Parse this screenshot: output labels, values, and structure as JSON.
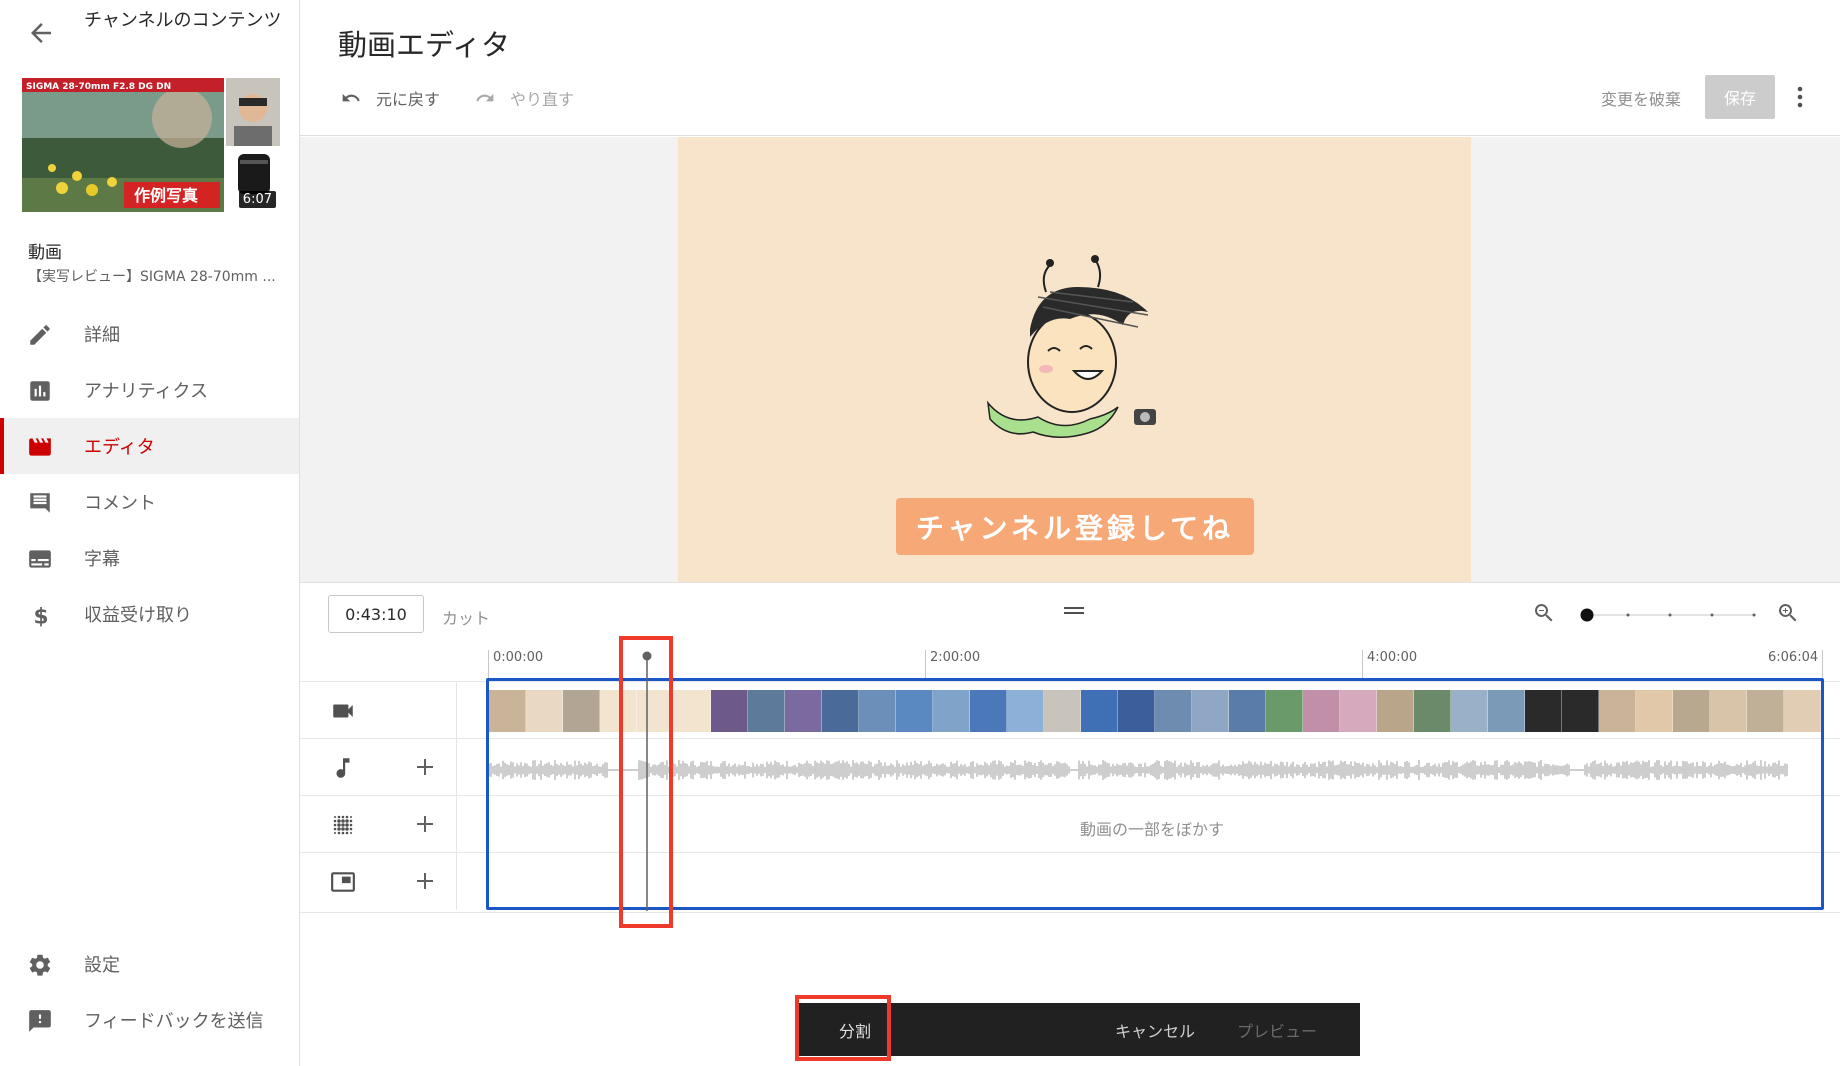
{
  "sidebar": {
    "channel_title": "チャンネルのコンテンツ",
    "thumbnail": {
      "header_text": "SIGMA 28-70mm F2.8 DG DN",
      "badge_text": "作例写真",
      "duration": "6:07"
    },
    "video_label": "動画",
    "video_name": "【実写レビュー】SIGMA 28-70mm ...",
    "nav_items": [
      {
        "label": "詳細",
        "icon": "pencil-icon"
      },
      {
        "label": "アナリティクス",
        "icon": "analytics-icon"
      },
      {
        "label": "エディタ",
        "icon": "clapperboard-icon",
        "active": true
      },
      {
        "label": "コメント",
        "icon": "comment-icon"
      },
      {
        "label": "字幕",
        "icon": "subtitles-icon"
      },
      {
        "label": "収益受け取り",
        "icon": "dollar-icon"
      }
    ],
    "footer_items": [
      {
        "label": "設定",
        "icon": "gear-icon"
      },
      {
        "label": "フィードバックを送信",
        "icon": "feedback-icon"
      }
    ]
  },
  "header": {
    "title": "動画エディタ",
    "undo_label": "元に戻す",
    "redo_label": "やり直す",
    "discard_label": "変更を破棄",
    "save_label": "保存"
  },
  "preview": {
    "banner_text": "チャンネル登録してね",
    "colors": {
      "background": "#f7e4cb",
      "banner": "#f6a877"
    }
  },
  "timeline": {
    "current_time": "0:43:10",
    "mode_label": "カット",
    "ruler_labels": [
      "0:00:00",
      "2:00:00",
      "4:00:00",
      "6:06:04"
    ],
    "blur_track_text": "動画の一部をぼかす",
    "track_icons": [
      "video-camera-icon",
      "music-note-icon",
      "blur-icon",
      "end-screen-icon"
    ],
    "zoom_level_fraction": 0.0,
    "playhead_fraction": 0.117
  },
  "bottom_bar": {
    "split_label": "分割",
    "cancel_label": "キャンセル",
    "preview_label": "プレビュー"
  },
  "colors": {
    "accent_red": "#cc0000",
    "clip_border": "#1a56c6",
    "highlight": "#ef3a2b"
  }
}
